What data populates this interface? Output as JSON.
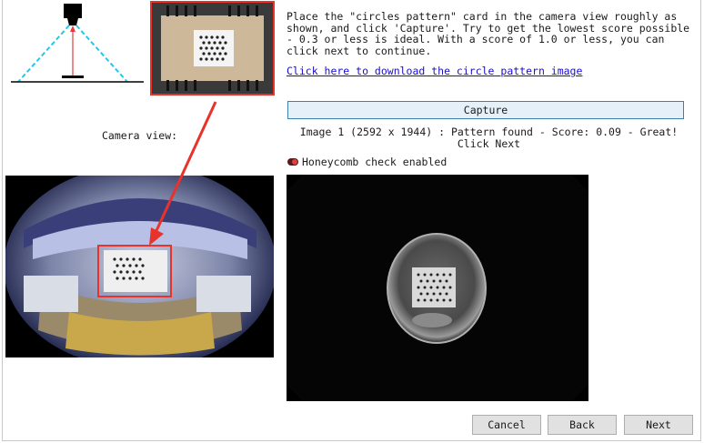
{
  "instructions": {
    "text": "Place the \"circles pattern\" card in the camera view roughly as shown, and click 'Capture'. Try to get the lowest score possible - 0.3 or less is ideal.  With a score of 1.0 or less, you can click next to continue.",
    "download_link": "Click here to download the circle pattern image"
  },
  "capture_label": "Capture",
  "status_text": "Image 1 (2592 x 1944) : Pattern found - Score: 0.09 - Great! Click Next",
  "honeycomb": {
    "label": "Honeycomb check enabled",
    "enabled": true
  },
  "camera_label": "Camera view:",
  "buttons": {
    "cancel": "Cancel",
    "back": "Back",
    "next": "Next"
  },
  "colors": {
    "highlight": "#e8332b",
    "link": "#1a0dcc",
    "capture_border": "#3c7fb1"
  }
}
